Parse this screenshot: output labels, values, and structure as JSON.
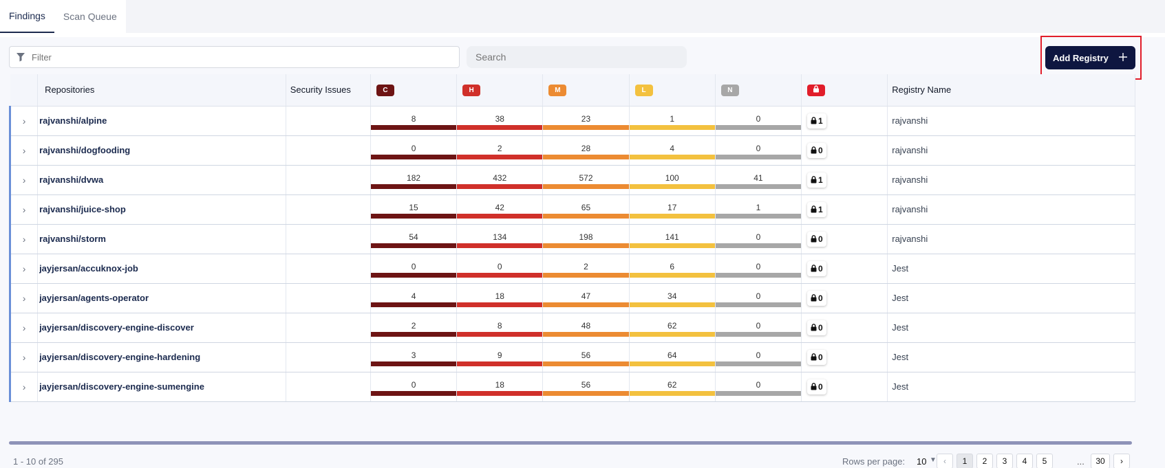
{
  "tabs": [
    {
      "label": "Findings",
      "active": true
    },
    {
      "label": "Scan Queue",
      "active": false
    }
  ],
  "toolbar": {
    "filter_placeholder": "Filter",
    "search_placeholder": "Search",
    "add_button_label": "Add Registry",
    "add_button_icon": "plus-icon"
  },
  "table": {
    "columns": {
      "repositories": "Repositories",
      "security_issues": "Security Issues",
      "critical": "C",
      "high": "H",
      "medium": "M",
      "low": "L",
      "negligible": "N",
      "lock_icon": "lock-icon",
      "registry_name": "Registry Name"
    },
    "severity_colors": {
      "C": "#6d1414",
      "H": "#d0302a",
      "M": "#ec8b32",
      "L": "#f3c13f",
      "N": "#a7a7a7",
      "lock": "#e11d2a"
    },
    "rows": [
      {
        "repo": "rajvanshi/alpine",
        "C": "8",
        "H": "38",
        "M": "23",
        "L": "1",
        "N": "0",
        "lock": "1",
        "registry": "rajvanshi"
      },
      {
        "repo": "rajvanshi/dogfooding",
        "C": "0",
        "H": "2",
        "M": "28",
        "L": "4",
        "N": "0",
        "lock": "0",
        "registry": "rajvanshi"
      },
      {
        "repo": "rajvanshi/dvwa",
        "C": "182",
        "H": "432",
        "M": "572",
        "L": "100",
        "N": "41",
        "lock": "1",
        "registry": "rajvanshi"
      },
      {
        "repo": "rajvanshi/juice-shop",
        "C": "15",
        "H": "42",
        "M": "65",
        "L": "17",
        "N": "1",
        "lock": "1",
        "registry": "rajvanshi"
      },
      {
        "repo": "rajvanshi/storm",
        "C": "54",
        "H": "134",
        "M": "198",
        "L": "141",
        "N": "0",
        "lock": "0",
        "registry": "rajvanshi"
      },
      {
        "repo": "jayjersan/accuknox-job",
        "C": "0",
        "H": "0",
        "M": "2",
        "L": "6",
        "N": "0",
        "lock": "0",
        "registry": "Jest"
      },
      {
        "repo": "jayjersan/agents-operator",
        "C": "4",
        "H": "18",
        "M": "47",
        "L": "34",
        "N": "0",
        "lock": "0",
        "registry": "Jest"
      },
      {
        "repo": "jayjersan/discovery-engine-discover",
        "C": "2",
        "H": "8",
        "M": "48",
        "L": "62",
        "N": "0",
        "lock": "0",
        "registry": "Jest"
      },
      {
        "repo": "jayjersan/discovery-engine-hardening",
        "C": "3",
        "H": "9",
        "M": "56",
        "L": "64",
        "N": "0",
        "lock": "0",
        "registry": "Jest"
      },
      {
        "repo": "jayjersan/discovery-engine-sumengine",
        "C": "0",
        "H": "18",
        "M": "56",
        "L": "62",
        "N": "0",
        "lock": "0",
        "registry": "Jest"
      }
    ]
  },
  "footer": {
    "range": "1 - 10 of 295",
    "rows_per_page_label": "Rows per page:",
    "rows_per_page_value": "10",
    "pages": [
      "1",
      "2",
      "3",
      "4",
      "5"
    ],
    "current_page": "1",
    "ellipsis": "...",
    "last_page": "30"
  }
}
